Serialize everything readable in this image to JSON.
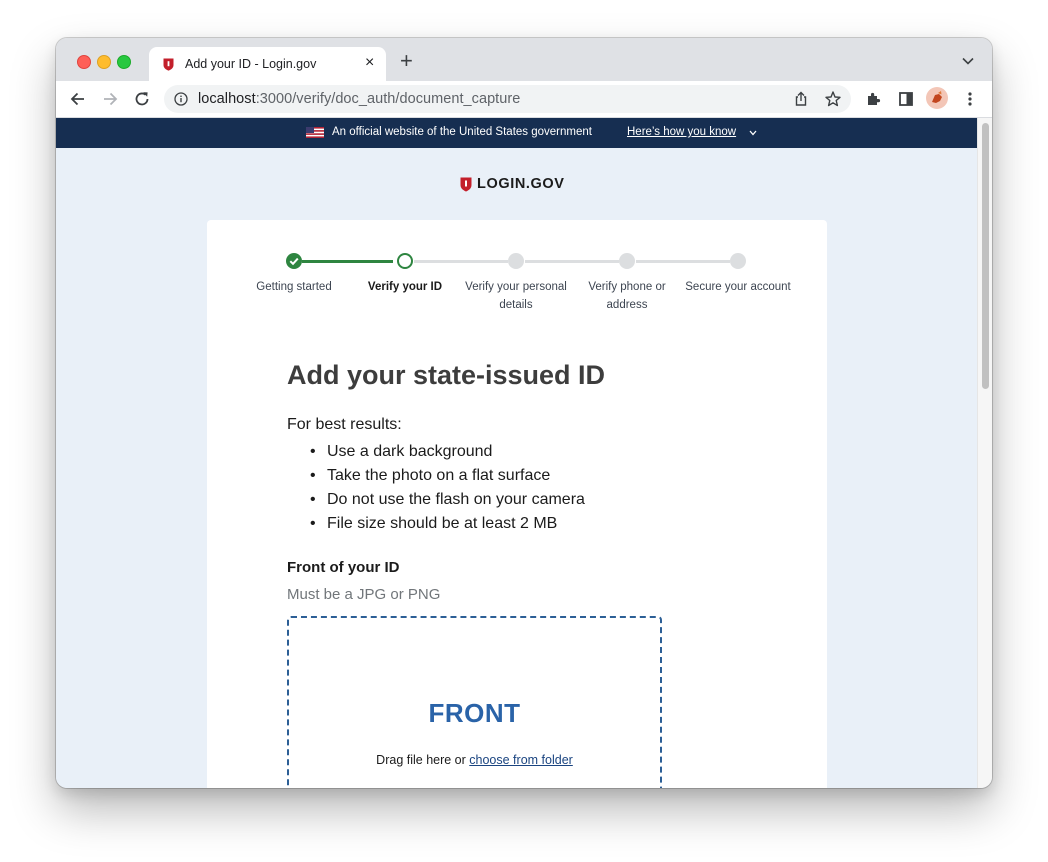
{
  "browser": {
    "tab_title": "Add your ID - Login.gov",
    "new_tab_label": "+",
    "close_tab_label": "×",
    "url_host": "localhost",
    "url_path": ":3000/verify/doc_auth/document_capture"
  },
  "banner": {
    "text": "An official website of the United States government",
    "link": "Here’s how you know"
  },
  "logo": {
    "text": "LOGIN.GOV"
  },
  "steps": [
    {
      "label": "Getting started",
      "status": "complete"
    },
    {
      "label": "Verify your ID",
      "status": "current"
    },
    {
      "label": "Verify your personal details",
      "status": "pending"
    },
    {
      "label": "Verify phone or address",
      "status": "pending"
    },
    {
      "label": "Secure your account",
      "status": "pending"
    }
  ],
  "main": {
    "title": "Add your state-issued ID",
    "intro": "For best results:",
    "tips": [
      "Use a dark background",
      "Take the photo on a flat surface",
      "Do not use the flash on your camera",
      "File size should be at least 2 MB"
    ],
    "front_label": "Front of your ID",
    "front_hint": "Must be a JPG or PNG",
    "dropzone_title": "FRONT",
    "dropzone_text": "Drag file here or ",
    "dropzone_link": "choose from folder"
  },
  "colors": {
    "banner_bg": "#162e51",
    "page_bg": "#e9f0f8",
    "step_complete": "#2e8540",
    "step_pending": "#dcdee0",
    "accent_blue": "#2a63a8",
    "logo_red": "#c31f2b"
  }
}
